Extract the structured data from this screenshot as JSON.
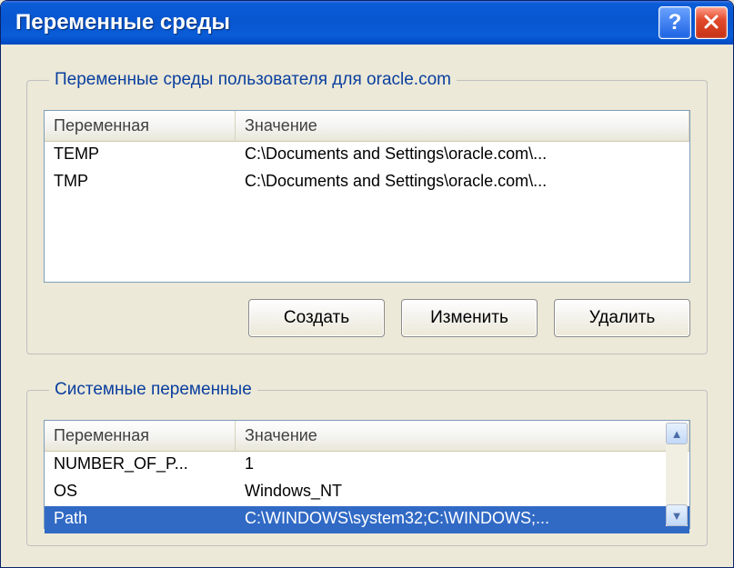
{
  "window": {
    "title": "Переменные среды"
  },
  "user_vars": {
    "legend": "Переменные среды пользователя для oracle.com",
    "columns": {
      "name": "Переменная",
      "value": "Значение"
    },
    "rows": [
      {
        "name": "TEMP",
        "value": "C:\\Documents and Settings\\oracle.com\\..."
      },
      {
        "name": "TMP",
        "value": "C:\\Documents and Settings\\oracle.com\\..."
      }
    ],
    "buttons": {
      "create": "Создать",
      "edit": "Изменить",
      "delete": "Удалить"
    }
  },
  "system_vars": {
    "legend": "Системные переменные",
    "columns": {
      "name": "Переменная",
      "value": "Значение"
    },
    "rows": [
      {
        "name": "NUMBER_OF_P...",
        "value": "1",
        "selected": false
      },
      {
        "name": "OS",
        "value": "Windows_NT",
        "selected": false
      },
      {
        "name": "Path",
        "value": "C:\\WINDOWS\\system32;C:\\WINDOWS;...",
        "selected": true
      }
    ]
  }
}
